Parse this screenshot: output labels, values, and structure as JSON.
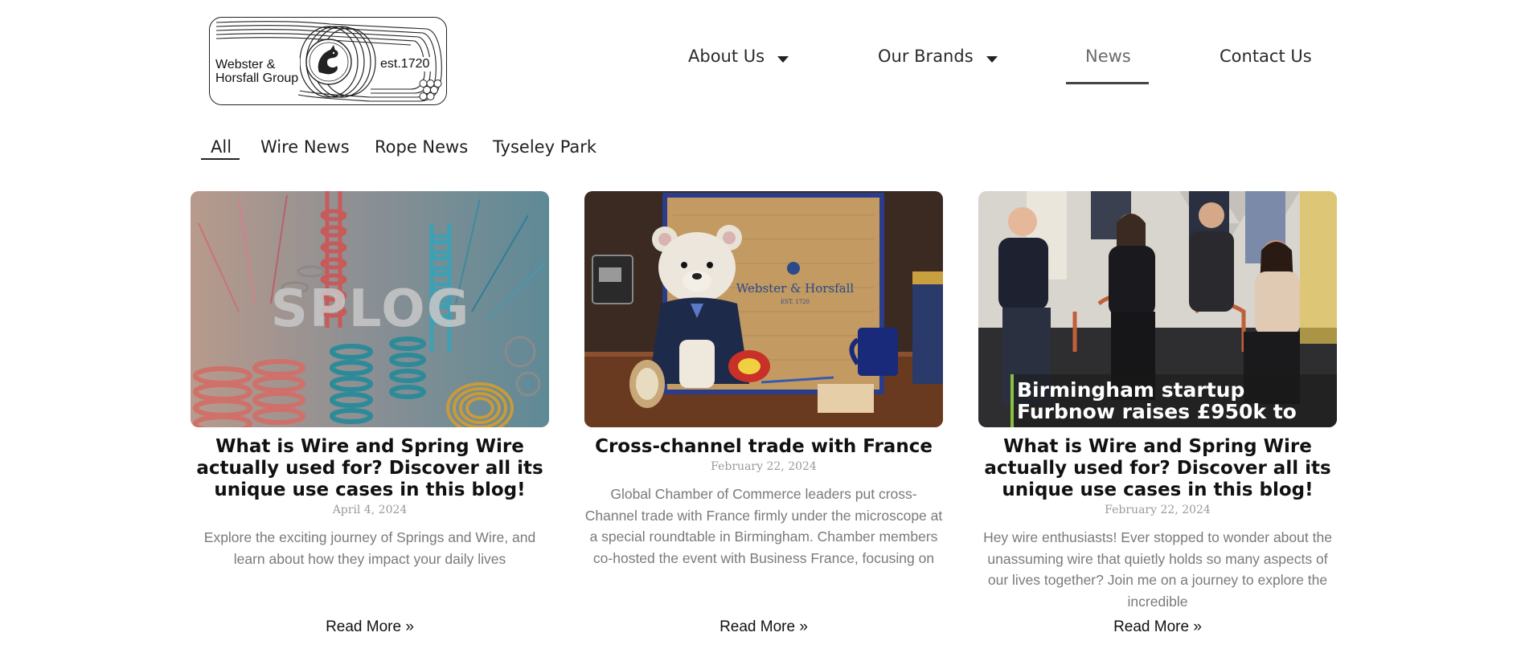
{
  "header": {
    "logo": {
      "name_text": "Webster &\nHorsfall Group",
      "est_text": "est.1720"
    },
    "nav": [
      {
        "label": "About Us",
        "has_dropdown": true,
        "active": false
      },
      {
        "label": "Our Brands",
        "has_dropdown": true,
        "active": false
      },
      {
        "label": "News",
        "has_dropdown": false,
        "active": true
      },
      {
        "label": "Contact Us",
        "has_dropdown": false,
        "active": false
      }
    ]
  },
  "filters": [
    {
      "label": "All",
      "active": true
    },
    {
      "label": "Wire News",
      "active": false
    },
    {
      "label": "Rope News",
      "active": false
    },
    {
      "label": "Tyseley Park",
      "active": false
    }
  ],
  "posts": [
    {
      "title": "What is Wire and Spring Wire actually used for? Discover all its unique use cases in this blog!",
      "date": "April 4, 2024",
      "excerpt": "Explore the exciting journey of Springs and Wire, and learn about how they impact your daily lives",
      "read_more": "Read More »",
      "image_text": "SPLOG",
      "image_icon": "springs-collage-image"
    },
    {
      "title": "Cross-channel trade with France",
      "date": "February 22, 2024",
      "excerpt": "Global Chamber of Commerce leaders put cross-Channel trade with France firmly under the microscope at a special roundtable in Birmingham. Chamber members co-hosted the event with Business France, focusing on",
      "read_more": "Read More »",
      "image_text": "Webster & Horsfall",
      "image_subtext": "EST. 1720",
      "image_icon": "teddy-bear-merchandise-image"
    },
    {
      "title": "What is Wire and Spring Wire actually used for? Discover all its unique use cases in this blog!",
      "date": "February 22, 2024",
      "excerpt": "Hey wire enthusiasts! Ever stopped to wonder about the unassuming wire that quietly holds so many aspects of our lives together? Join me on a journey to explore the incredible",
      "read_more": "Read More »",
      "image_text": "Birmingham startup Furbnow raises £950k to",
      "image_icon": "team-photo-image"
    }
  ],
  "colors": {
    "nav_underline": "#444444",
    "excerpt_text": "#7a7a7a",
    "date_text": "#9a9a9a"
  }
}
